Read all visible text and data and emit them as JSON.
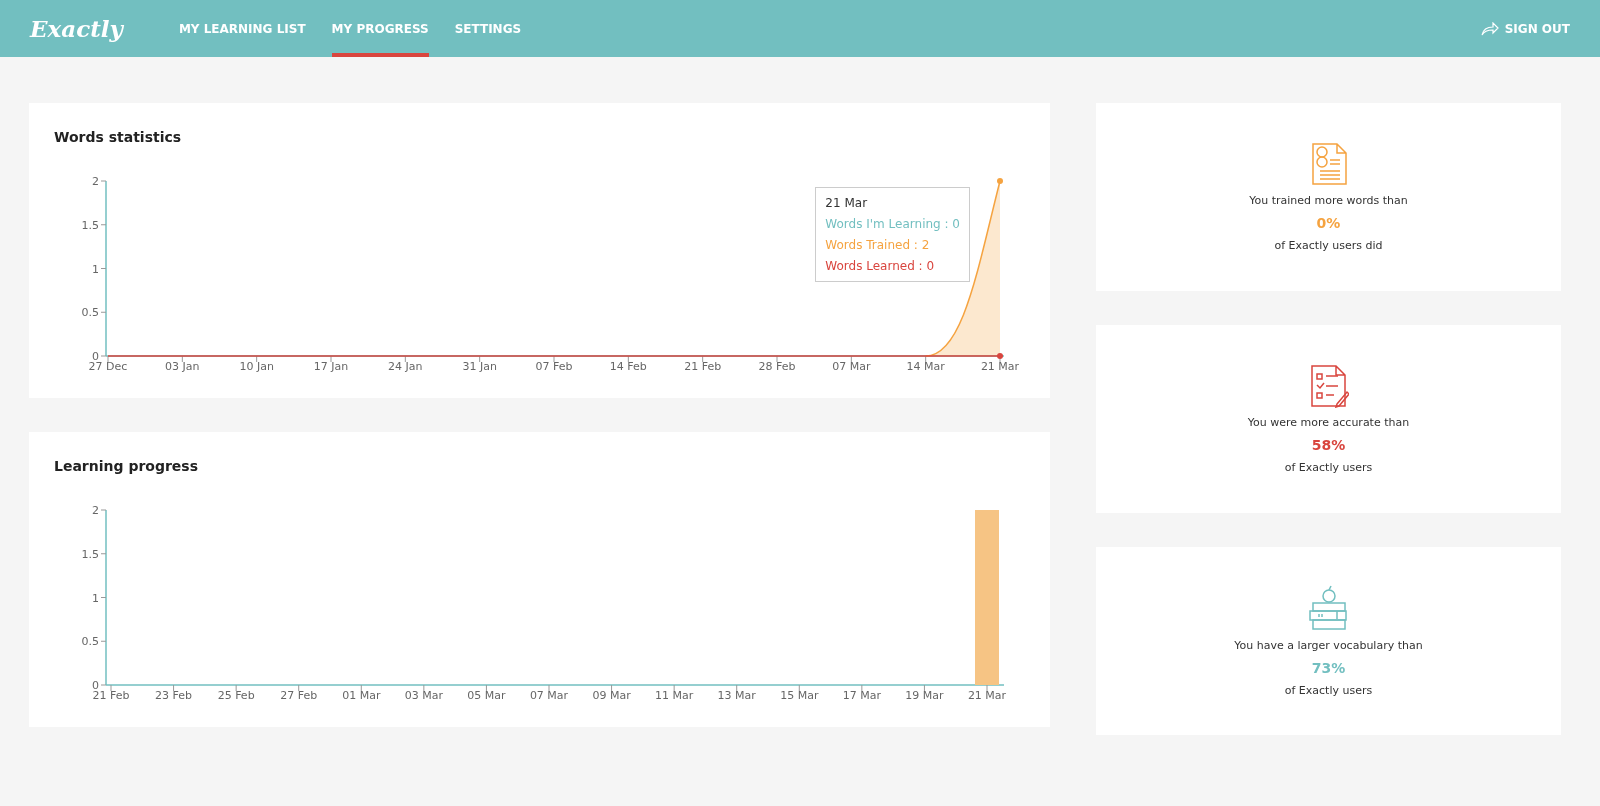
{
  "header": {
    "logo": "Exactly",
    "nav": [
      {
        "label": "MY LEARNING LIST",
        "selected": false
      },
      {
        "label": "MY PROGRESS",
        "selected": true
      },
      {
        "label": "SETTINGS",
        "selected": false
      }
    ],
    "sign_out": "SIGN OUT"
  },
  "words_statistics": {
    "chart_data": {
      "type": "line",
      "title": "Words statistics",
      "categories": [
        "27 Dec",
        "03 Jan",
        "10 Jan",
        "17 Jan",
        "24 Jan",
        "31 Jan",
        "07 Feb",
        "14 Feb",
        "21 Feb",
        "28 Feb",
        "07 Mar",
        "14 Mar",
        "21 Mar"
      ],
      "ylim": [
        0,
        2
      ],
      "yticks": [
        0,
        0.5,
        1,
        1.5,
        2
      ],
      "series": [
        {
          "color": "#f5a340",
          "values": [
            null,
            null,
            null,
            null,
            null,
            null,
            null,
            null,
            null,
            null,
            null,
            0,
            2
          ]
        },
        {
          "color": "#d9453e",
          "values": [
            0,
            0,
            0,
            0,
            0,
            0,
            0,
            0,
            0,
            0,
            0,
            0,
            0
          ]
        }
      ]
    },
    "tooltip": {
      "title": "21 Mar",
      "lines": [
        {
          "text": "Words I'm Learning : 0",
          "color": "#72bfc0"
        },
        {
          "text": "Words Trained : 2",
          "color": "#f5a340"
        },
        {
          "text": "Words Learned : 0",
          "color": "#d9453e"
        }
      ]
    }
  },
  "learning_progress": {
    "chart_data": {
      "type": "bar",
      "title": "Learning progress",
      "categories": [
        "21 Feb",
        "23 Feb",
        "25 Feb",
        "27 Feb",
        "01 Mar",
        "03 Mar",
        "05 Mar",
        "07 Mar",
        "09 Mar",
        "11 Mar",
        "13 Mar",
        "15 Mar",
        "17 Mar",
        "19 Mar",
        "21 Mar"
      ],
      "ylim": [
        0,
        2
      ],
      "yticks": [
        0,
        0.5,
        1,
        1.5,
        2
      ],
      "series": [
        {
          "color": "#f6c484",
          "values": [
            0,
            0,
            0,
            0,
            0,
            0,
            0,
            0,
            0,
            0,
            0,
            0,
            0,
            0,
            2
          ]
        }
      ]
    }
  },
  "stats": [
    {
      "kind": "trained",
      "color": "#f5a340",
      "before": "You trained more words than",
      "value": "0%",
      "after": "of Exactly users did"
    },
    {
      "kind": "accuracy",
      "color": "#d9453e",
      "before": "You were more accurate than",
      "value": "58%",
      "after": "of Exactly users"
    },
    {
      "kind": "vocabulary",
      "color": "#72bfc0",
      "before": "You have a larger vocabulary than",
      "value": "73%",
      "after": "of Exactly users"
    }
  ]
}
